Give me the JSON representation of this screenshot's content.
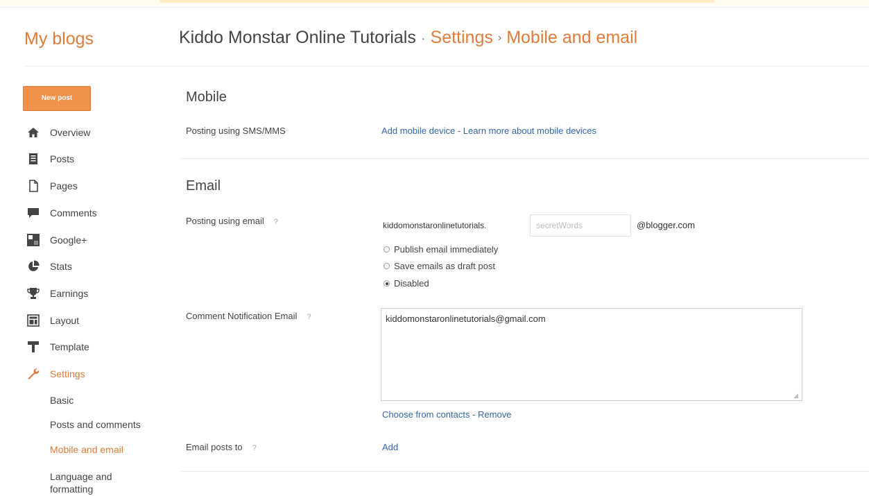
{
  "header": {
    "brand": "My blogs",
    "blog_title": "Kiddo Monstar Online Tutorials",
    "separator": "·",
    "arrow": "›",
    "crumb_settings": "Settings",
    "crumb_page": "Mobile and email"
  },
  "sidebar": {
    "new_post": "New post",
    "items": [
      {
        "label": "Overview",
        "icon": "home-icon"
      },
      {
        "label": "Posts",
        "icon": "posts-icon"
      },
      {
        "label": "Pages",
        "icon": "pages-icon"
      },
      {
        "label": "Comments",
        "icon": "comments-icon"
      },
      {
        "label": "Google+",
        "icon": "google-plus-icon"
      },
      {
        "label": "Stats",
        "icon": "stats-icon"
      },
      {
        "label": "Earnings",
        "icon": "trophy-icon"
      },
      {
        "label": "Layout",
        "icon": "layout-icon"
      },
      {
        "label": "Template",
        "icon": "template-icon"
      },
      {
        "label": "Settings",
        "icon": "wrench-icon",
        "active": true
      }
    ],
    "subitems": [
      {
        "label": "Basic"
      },
      {
        "label": "Posts and comments"
      },
      {
        "label": "Mobile and email",
        "active": true
      },
      {
        "label": "Language and formatting"
      }
    ]
  },
  "mobile": {
    "title": "Mobile",
    "sms_label": "Posting using SMS/MMS",
    "add_device": "Add mobile device",
    "dash": " - ",
    "learn_more": "Learn more about mobile devices"
  },
  "email": {
    "title": "Email",
    "posting_label": "Posting using email",
    "help": "?",
    "address_prefix": "kiddomonstaronlinetutorials.",
    "secret_placeholder": "secretWords",
    "address_suffix": "@blogger.com",
    "options": [
      {
        "label": "Publish email immediately",
        "checked": false
      },
      {
        "label": "Save emails as draft post",
        "checked": false
      },
      {
        "label": "Disabled",
        "checked": true
      }
    ],
    "notify_label": "Comment Notification Email",
    "notify_value": "kiddomonstaronlinetutorials@gmail.com",
    "choose_contacts": "Choose from contacts",
    "dash": " - ",
    "remove": "Remove",
    "email_posts_label": "Email posts to",
    "add": "Add"
  },
  "colors": {
    "accent": "#e07b39",
    "button": "#f2914a",
    "link": "#3366aa"
  }
}
